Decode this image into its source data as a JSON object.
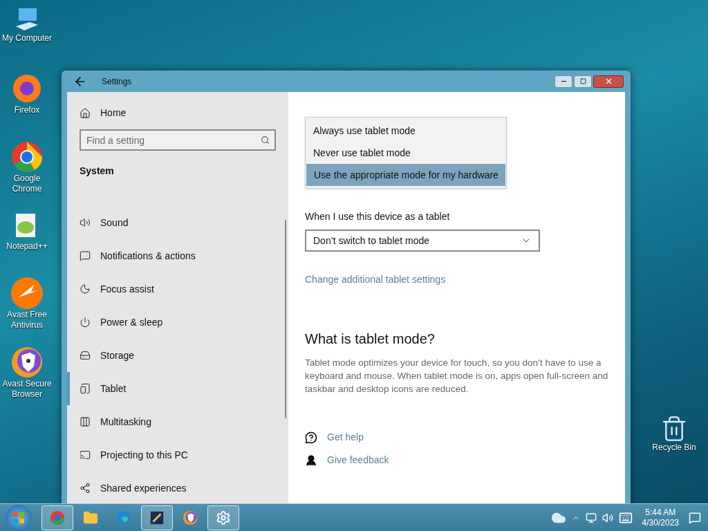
{
  "desktop_icons": [
    {
      "label": "My Computer"
    },
    {
      "label": "Firefox"
    },
    {
      "label": "Google Chrome"
    },
    {
      "label": "Notepad++"
    },
    {
      "label": "Avast Free Antivirus"
    },
    {
      "label": "Avast Secure Browser"
    },
    {
      "label": "Recycle Bin"
    }
  ],
  "window": {
    "title": "Settings"
  },
  "sidebar": {
    "home": "Home",
    "search": {
      "placeholder": "Find a setting"
    },
    "section": "System",
    "items": [
      {
        "label": "Sound",
        "selected": false
      },
      {
        "label": "Notifications & actions",
        "selected": false
      },
      {
        "label": "Focus assist",
        "selected": false
      },
      {
        "label": "Power & sleep",
        "selected": false
      },
      {
        "label": "Storage",
        "selected": false
      },
      {
        "label": "Tablet",
        "selected": true
      },
      {
        "label": "Multitasking",
        "selected": false
      },
      {
        "label": "Projecting to this PC",
        "selected": false
      },
      {
        "label": "Shared experiences",
        "selected": false
      }
    ]
  },
  "content": {
    "dropdown_options": [
      {
        "label": "Always use tablet mode",
        "selected": false
      },
      {
        "label": "Never use tablet mode",
        "selected": false
      },
      {
        "label": "Use the appropriate mode for my hardware",
        "selected": true
      }
    ],
    "tablet_label": "When I use this device as a tablet",
    "tablet_value": "Don’t switch to tablet mode",
    "link": "Change additional tablet settings",
    "about_title": "What is tablet mode?",
    "about_text": "Tablet mode optimizes your device for touch, so you don’t have to use a keyboard and mouse. When tablet mode is on, apps open full-screen and taskbar and desktop icons are reduced.",
    "help_links": [
      "Get help",
      "Give feedback"
    ]
  },
  "taskbar": {
    "apps": [
      {
        "running": true
      },
      {
        "running": false
      },
      {
        "running": false
      },
      {
        "running": true
      },
      {
        "running": false
      },
      {
        "running": true
      }
    ],
    "time": "5:44 AM",
    "date": "4/30/2023"
  }
}
